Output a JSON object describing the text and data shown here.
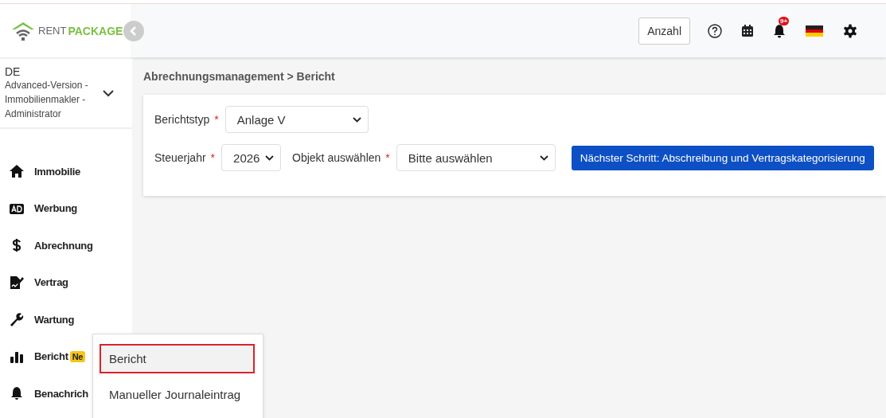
{
  "logo": {
    "part_1": "RENT",
    "part_2": "PACKAGE"
  },
  "account": {
    "code": "DE",
    "role": "Advanced-Version - Immobilienmakler - Administrator"
  },
  "sidebar": {
    "items": [
      {
        "kind": "house",
        "label": "Immobilie",
        "selected": false
      },
      {
        "kind": "ad",
        "label": "Werbung",
        "selected": false
      },
      {
        "kind": "dollar",
        "label": "Abrechnung",
        "selected": false
      },
      {
        "kind": "contract",
        "label": "Vertrag",
        "selected": false
      },
      {
        "kind": "wrench",
        "label": "Wartung",
        "selected": false
      },
      {
        "kind": "chart",
        "label": "Bericht",
        "selected": false,
        "badge": "Ne"
      },
      {
        "kind": "bell",
        "label": "Benachrich",
        "selected": false
      }
    ]
  },
  "submenu": {
    "items": [
      {
        "label": "Bericht",
        "selected": true
      },
      {
        "label": "Manueller Journaleintrag",
        "selected": false
      }
    ]
  },
  "header": {
    "button": "Anzahl",
    "notification_badge": "9+"
  },
  "breadcrumb": "Abrechnungsmanagement > Bericht",
  "form": {
    "required_mark": "*",
    "rows": [
      {
        "fields": [
          {
            "label": "Berichtstyp",
            "required": true,
            "value": "Anlage V"
          }
        ]
      },
      {
        "fields": [
          {
            "label": "Steuerjahr",
            "required": true,
            "value": "2026"
          },
          {
            "label": "Objekt auswählen",
            "required": true,
            "value": "Bitte auswählen"
          }
        ],
        "button": "Nächster Schritt: Abschreibung und Vertragskategorisierung"
      }
    ]
  }
}
